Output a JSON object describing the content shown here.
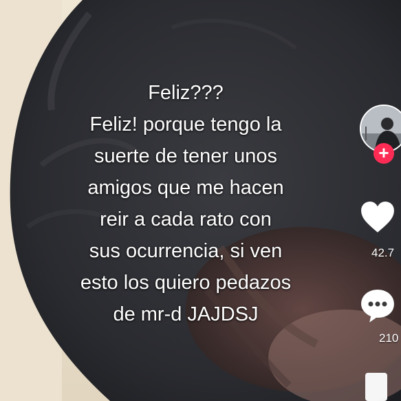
{
  "video": {
    "caption_lines": [
      "Feliz???",
      "Feliz! porque tengo la",
      "suerte de tener unos",
      "amigos que me hacen",
      "reir a cada rato con",
      "sus ocurrencia, si ven",
      "esto los quiero pedazos",
      "de mr-d JAJDSJ"
    ]
  },
  "sidebar": {
    "follow_label": "+",
    "like_count": "42.7",
    "comment_count": "210"
  },
  "icons": {
    "avatar": "profile-avatar",
    "follow": "plus-icon",
    "like": "heart-icon",
    "comment": "speech-bubble-icon",
    "share": "share-icon"
  },
  "colors": {
    "follow_accent": "#fe2c55",
    "icon_fill": "#ffffff",
    "caption_text": "#ffffff"
  }
}
